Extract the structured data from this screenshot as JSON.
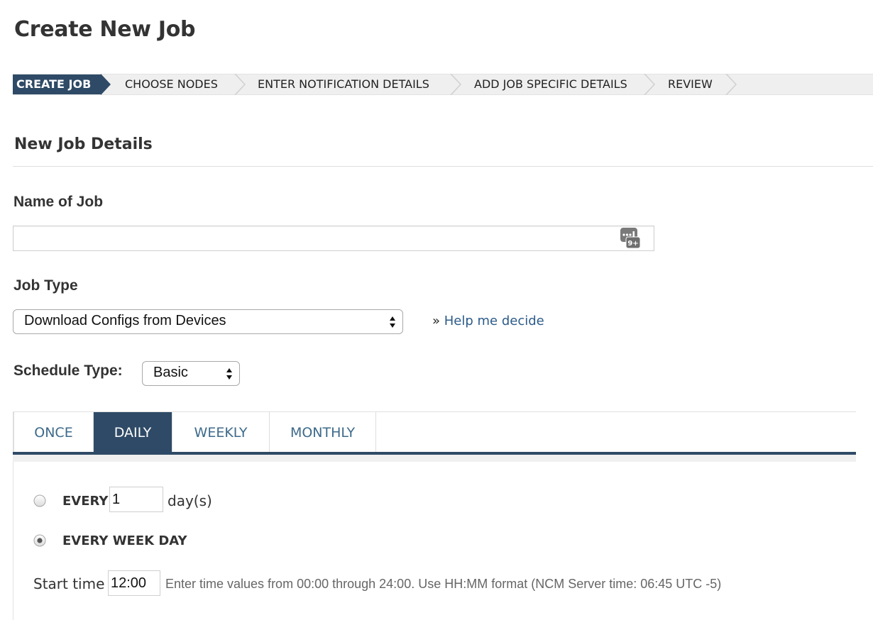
{
  "page": {
    "title": "Create New Job"
  },
  "wizard": {
    "steps": [
      {
        "label": "CREATE JOB",
        "active": true
      },
      {
        "label": "CHOOSE NODES",
        "active": false
      },
      {
        "label": "ENTER NOTIFICATION DETAILS",
        "active": false
      },
      {
        "label": "ADD JOB SPECIFIC DETAILS",
        "active": false
      },
      {
        "label": "REVIEW",
        "active": false
      }
    ]
  },
  "section": {
    "title": "New Job Details"
  },
  "form": {
    "name_label": "Name of Job",
    "name_value": "",
    "name_icon_badge": "9+",
    "job_type_label": "Job Type",
    "job_type_value": "Download Configs from Devices",
    "help_prefix": "»",
    "help_link": "Help me decide",
    "schedule_label": "Schedule Type:",
    "schedule_value": "Basic"
  },
  "tabs": [
    {
      "label": "ONCE",
      "active": false
    },
    {
      "label": "DAILY",
      "active": true
    },
    {
      "label": "WEEKLY",
      "active": false
    },
    {
      "label": "MONTHLY",
      "active": false
    }
  ],
  "daily": {
    "every_label": "EVERY",
    "every_value": "1",
    "every_unit": "day(s)",
    "every_selected": false,
    "weekday_label": "EVERY WEEK DAY",
    "weekday_selected": true,
    "start_label": "Start time",
    "start_value": "12:00",
    "start_hint": "Enter time values from 00:00 through 24:00. Use HH:MM format (NCM Server time: 06:45 UTC -5)"
  },
  "colors": {
    "accent": "#2e4a66",
    "link": "#2c5b8a",
    "tab_text": "#3d6a8a"
  },
  "icons": {
    "name_field_icon": "keyboard-badge-icon",
    "radio_on": "radio-selected-icon",
    "radio_off": "radio-unselected-icon"
  }
}
